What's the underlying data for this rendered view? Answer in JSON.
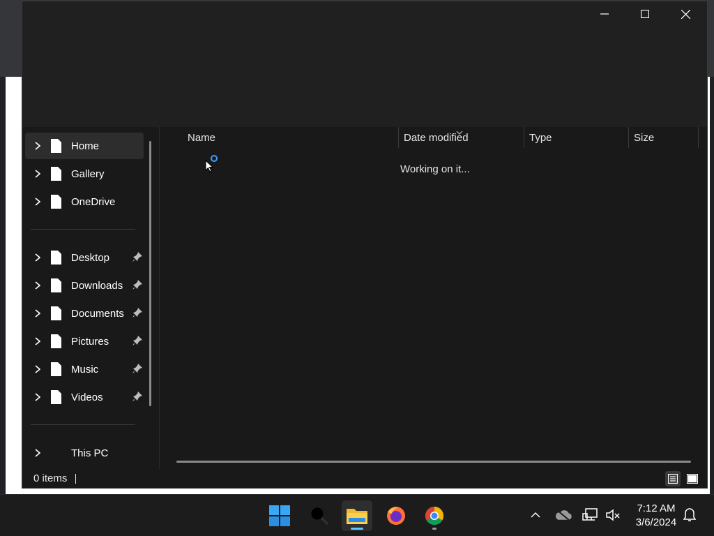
{
  "window": {
    "controls": [
      "minimize",
      "maximize",
      "close"
    ]
  },
  "navigation": {
    "items": [
      {
        "label": "Home",
        "icon": "file-icon",
        "pinned": false,
        "selected": true
      },
      {
        "label": "Gallery",
        "icon": "file-icon",
        "pinned": false
      },
      {
        "label": "OneDrive",
        "icon": "file-icon",
        "pinned": false
      }
    ],
    "quick_access": [
      {
        "label": "Desktop",
        "icon": "file-icon",
        "pinned": true
      },
      {
        "label": "Downloads",
        "icon": "file-icon",
        "pinned": true
      },
      {
        "label": "Documents",
        "icon": "file-icon",
        "pinned": true
      },
      {
        "label": "Pictures",
        "icon": "file-icon",
        "pinned": true
      },
      {
        "label": "Music",
        "icon": "file-icon",
        "pinned": true
      },
      {
        "label": "Videos",
        "icon": "file-icon",
        "pinned": true
      }
    ],
    "this_pc": {
      "label": "This PC"
    }
  },
  "file_list": {
    "columns": [
      "Name",
      "Date modified",
      "Type",
      "Size"
    ],
    "status_message": "Working on it..."
  },
  "status_bar": {
    "item_count": "0 items"
  },
  "taskbar": {
    "apps": [
      "windows-start-icon",
      "search-icon",
      "file-explorer-icon",
      "firefox-icon",
      "chrome-icon"
    ],
    "clock": {
      "time": "7:12 AM",
      "date": "3/6/2024"
    }
  },
  "colors": {
    "accent": "#3aa0ff",
    "window_bg": "#191919",
    "titlebar_bg": "#202020"
  }
}
